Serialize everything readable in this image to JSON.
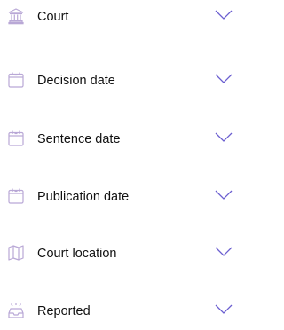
{
  "filters": {
    "items": [
      {
        "label": "Court",
        "icon": "courthouse-icon"
      },
      {
        "label": "Decision date",
        "icon": "calendar-icon"
      },
      {
        "label": "Sentence date",
        "icon": "calendar-icon"
      },
      {
        "label": "Publication date",
        "icon": "calendar-icon"
      },
      {
        "label": "Court location",
        "icon": "map-icon"
      },
      {
        "label": "Reported",
        "icon": "inbox-icon"
      }
    ]
  },
  "colors": {
    "icon": "#b9a8d6",
    "chevron": "#6b5fd0",
    "text": "#111111"
  }
}
